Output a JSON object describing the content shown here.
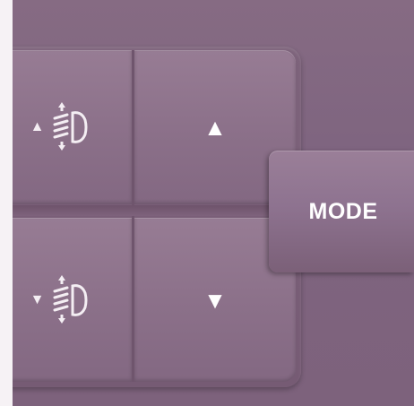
{
  "panel": {
    "mode_button": {
      "label": "MODE"
    },
    "keys": {
      "beam_up": {
        "icon": "headlight-beam-up-icon",
        "arrow": "▲"
      },
      "up": {
        "icon": "arrow-up-icon",
        "arrow": "▲"
      },
      "beam_down": {
        "icon": "headlight-beam-down-icon",
        "arrow": "▼"
      },
      "down": {
        "icon": "arrow-down-icon",
        "arrow": "▼"
      }
    }
  },
  "colors": {
    "panel_bg": "#866b83",
    "key_face": "#8b7089",
    "label": "#ffffff"
  }
}
